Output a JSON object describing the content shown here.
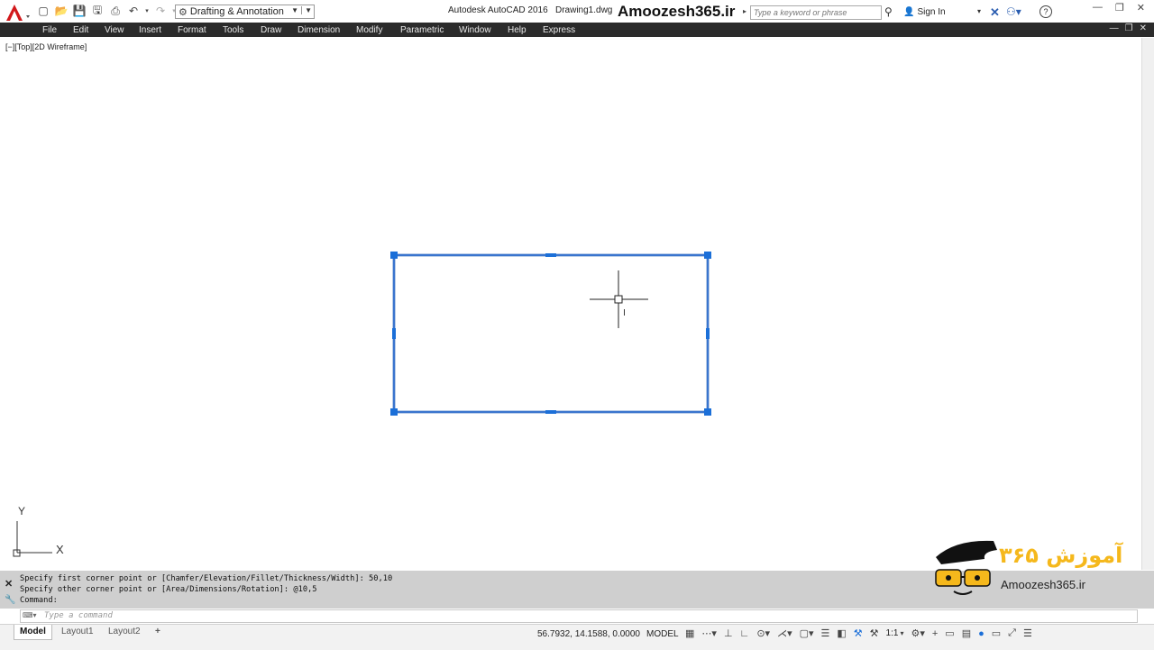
{
  "titlebar": {
    "workspace": "Drafting & Annotation",
    "app_title": "Autodesk AutoCAD 2016",
    "doc_title": "Drawing1.dwg",
    "watermark": "Amoozesh365.ir",
    "search_placeholder": "Type a keyword or phrase",
    "sign_in": "Sign In"
  },
  "menu": [
    "File",
    "Edit",
    "View",
    "Insert",
    "Format",
    "Tools",
    "Draw",
    "Dimension",
    "Modify",
    "Parametric",
    "Window",
    "Help",
    "Express"
  ],
  "viewport_label": "[−][Top][2D Wireframe]",
  "ucs": {
    "x_label": "X",
    "y_label": "Y"
  },
  "command": {
    "history": [
      "Specify first corner point or [Chamfer/Elevation/Fillet/Thickness/Width]: 50,10",
      "Specify other corner point or [Area/Dimensions/Rotation]: @10,5",
      "Command:"
    ],
    "placeholder": "Type a command"
  },
  "tabs": [
    "Model",
    "Layout1",
    "Layout2"
  ],
  "status": {
    "coordinates": "56.7932, 14.1588, 0.0000",
    "mode": "MODEL",
    "scale": "1:1"
  },
  "logo": {
    "persian_text": "آموزش ۳۶۵",
    "latin_text": "Amoozesh365.ir"
  },
  "colors": {
    "accent": "#1b6fd8",
    "menubar": "#2b2b2b",
    "cmdline": "#cfcfcf",
    "logo_yellow": "#f5b81c"
  }
}
